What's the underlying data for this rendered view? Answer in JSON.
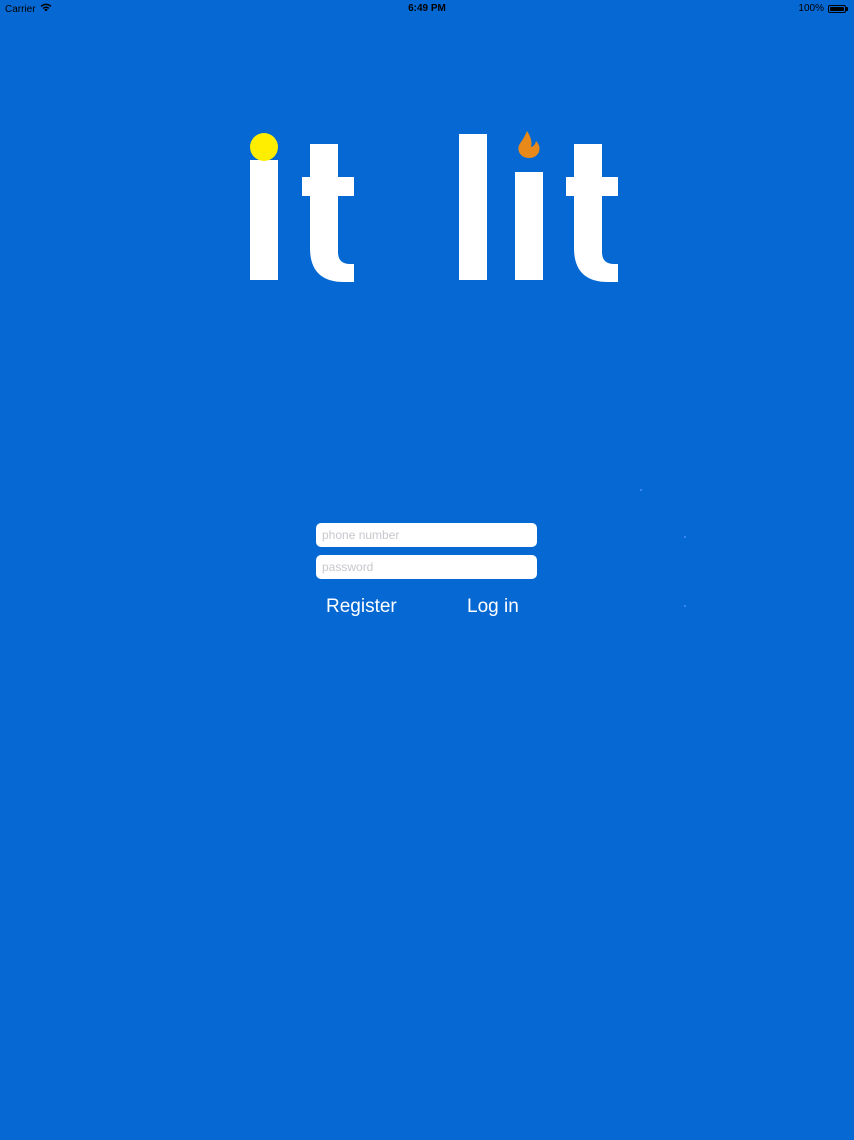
{
  "status_bar": {
    "carrier": "Carrier",
    "time": "6:49 PM",
    "battery": "100%",
    "battery_level": 1.0,
    "wifi_icon": "wifi-icon",
    "battery_icon": "battery-icon"
  },
  "logo": {
    "word_one": "it",
    "word_two": "lit",
    "dot_color": "#ffee00",
    "flame_color": "#e8891a"
  },
  "login_form": {
    "phone_placeholder": "phone number",
    "phone_value": "",
    "password_placeholder": "password",
    "password_value": "",
    "register_label": "Register",
    "login_label": "Log in"
  },
  "colors": {
    "background": "#0568d3",
    "text": "#ffffff"
  }
}
